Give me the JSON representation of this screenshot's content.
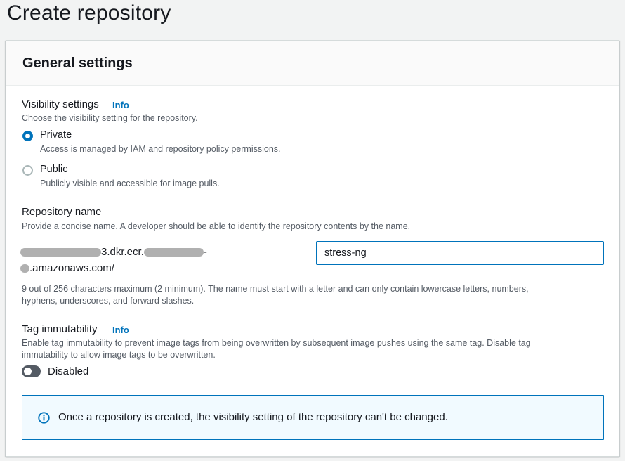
{
  "page": {
    "title": "Create repository"
  },
  "general_settings": {
    "title": "General settings",
    "visibility": {
      "label": "Visibility settings",
      "info": "Info",
      "description": "Choose the visibility setting for the repository.",
      "options": [
        {
          "label": "Private",
          "description": "Access is managed by IAM and repository policy permissions.",
          "checked": true
        },
        {
          "label": "Public",
          "description": "Publicly visible and accessible for image pulls.",
          "checked": false
        }
      ]
    },
    "repository_name": {
      "label": "Repository name",
      "description": "Provide a concise name. A developer should be able to identify the repository contents by the name.",
      "uri_part1": "3.dkr.ecr.",
      "uri_part1_suffix": "-",
      "uri_part2": ".amazonaws.com/",
      "value": "stress-ng",
      "constraint_line1": "9 out of 256 characters maximum (2 minimum). The name must start with a letter and can only contain lowercase letters, numbers,",
      "constraint_line2": "hyphens, underscores, and forward slashes."
    },
    "tag_immutability": {
      "label": "Tag immutability",
      "info": "Info",
      "description_line1": "Enable tag immutability to prevent image tags from being overwritten by subsequent image pushes using the same tag. Disable tag",
      "description_line2": "immutability to allow image tags to be overwritten.",
      "toggle_state": "Disabled",
      "enabled": false
    },
    "alert": {
      "icon": "info-circle-icon",
      "text": "Once a repository is created, the visibility setting of the repository can't be changed."
    }
  },
  "colors": {
    "accent": "#0073bb",
    "alert_background": "#f1faff",
    "toggle_off": "#545b64"
  }
}
